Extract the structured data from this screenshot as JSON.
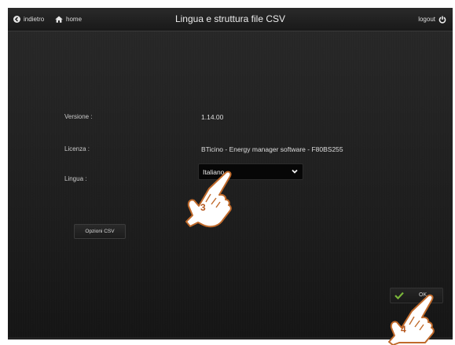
{
  "header": {
    "back_label": "indietro",
    "home_label": "home",
    "title": "Lingua e struttura file CSV",
    "logout_label": "logout"
  },
  "form": {
    "version_label": "Versione :",
    "version_value": "1.14.00",
    "license_label": "Licenza :",
    "license_value": "BTicino - Energy manager software - F80BS255",
    "language_label": "Lingua :",
    "language_selected": "Italiano"
  },
  "buttons": {
    "csv_options_label": "Opzioni CSV",
    "ok_label": "OK"
  },
  "annotations": {
    "step3": "3",
    "step4": "4"
  },
  "colors": {
    "check_icon": "#7ab63a",
    "step_number": "#b5571e"
  }
}
